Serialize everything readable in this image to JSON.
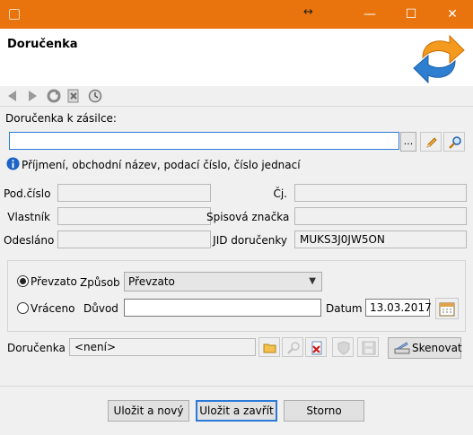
{
  "window": {
    "title": "Doručenka",
    "resize_glyph": "↔",
    "minimize": "—",
    "maximize": "☐",
    "close": "✕"
  },
  "toolbar": {
    "icons": [
      "back-arrow-icon",
      "forward-arrow-icon",
      "refresh-icon",
      "delete-page-icon",
      "history-icon"
    ]
  },
  "search": {
    "label": "Doručenka k zásilce:",
    "value": "",
    "ellipsis": "...",
    "hint": "Příjmení, obchodní název, podací číslo, číslo jednací"
  },
  "info": {
    "podcislo_label": "Pod.číslo",
    "podcislo_value": "",
    "cj_label": "Čj.",
    "cj_value": "",
    "vlastnik_label": "Vlastník",
    "vlastnik_value": "",
    "spisova_label": "Spisová značka",
    "spisova_value": "",
    "odeslano_label": "Odesláno",
    "odeslano_value": "",
    "jid_label": "JID doručenky",
    "jid_value": "MUKS3J0JW5ON"
  },
  "status": {
    "prevzato_label": "Převzato",
    "prevzato_selected": true,
    "zpusob_label": "Způsob",
    "zpusob_value": "Převzato",
    "vraceno_label": "Vráceno",
    "duvod_label": "Důvod",
    "duvod_value": "",
    "datum_label": "Datum",
    "datum_value": "13.03.2017"
  },
  "document": {
    "label": "Doručenka",
    "value": "<není>",
    "scan_label": "Skenovat"
  },
  "buttons": {
    "save_new": "Uložit a nový",
    "save_close": "Uložit a zavřít",
    "cancel": "Storno"
  },
  "colors": {
    "titlebar": "#e9730d",
    "focus": "#2a7ad6",
    "logo_orange": "#f39a1f",
    "logo_blue": "#2f7fd0"
  }
}
